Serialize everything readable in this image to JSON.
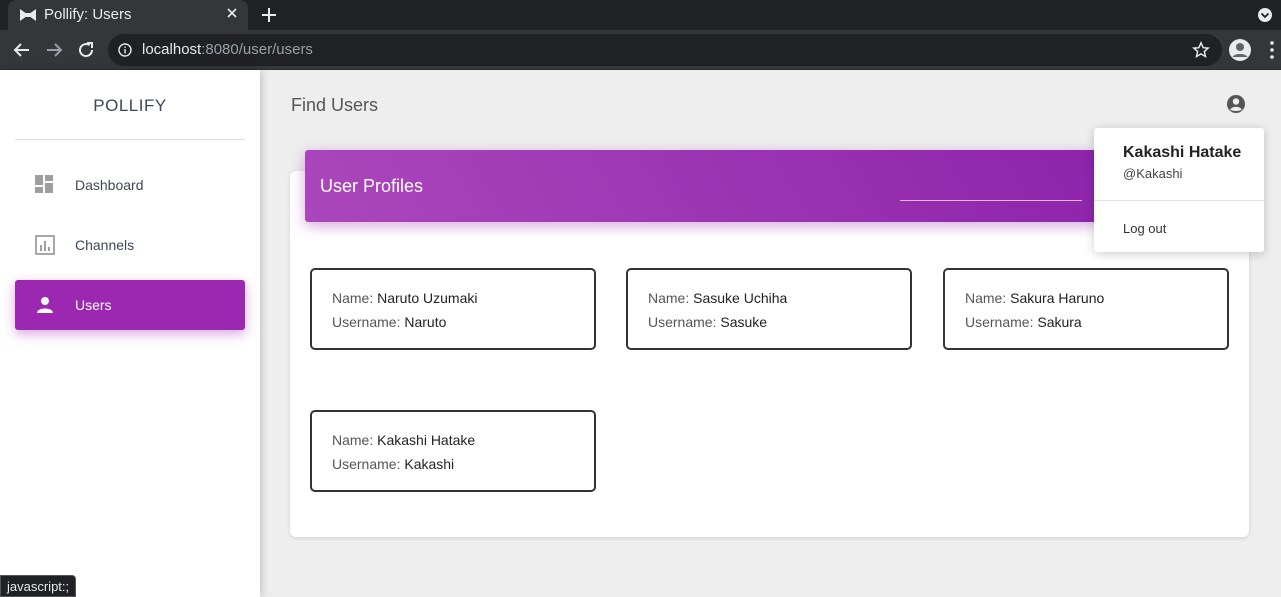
{
  "browser": {
    "tab_title": "Pollify: Users",
    "url_host": "localhost",
    "url_rest": ":8080/user/users",
    "status_text": "javascript:;"
  },
  "sidebar": {
    "logo": "POLLIFY",
    "items": [
      {
        "label": "Dashboard",
        "icon": "dashboard-icon"
      },
      {
        "label": "Channels",
        "icon": "bar-chart-icon"
      },
      {
        "label": "Users",
        "icon": "person-icon",
        "active": true
      }
    ]
  },
  "header": {
    "title": "Find Users"
  },
  "card": {
    "title": "User Profiles",
    "name_label": "Name:",
    "username_label": "Username:",
    "profiles": [
      {
        "name": "Naruto Uzumaki",
        "username": "Naruto"
      },
      {
        "name": "Sasuke Uchiha",
        "username": "Sasuke"
      },
      {
        "name": "Sakura Haruno",
        "username": "Sakura"
      },
      {
        "name": "Kakashi Hatake",
        "username": "Kakashi"
      }
    ]
  },
  "account_menu": {
    "name": "Kakashi Hatake",
    "handle": "@Kakashi",
    "logout": "Log out"
  },
  "colors": {
    "accent": "#9c27b0",
    "chrome_dark": "#202124",
    "chrome_mid": "#35363a"
  }
}
